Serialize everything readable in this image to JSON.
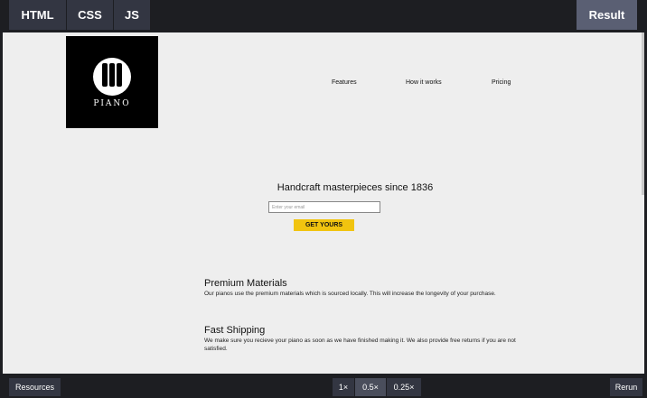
{
  "editor": {
    "tabs": [
      {
        "label": "HTML"
      },
      {
        "label": "CSS"
      },
      {
        "label": "JS"
      }
    ],
    "result_label": "Result",
    "resources_label": "Resources",
    "zoom_options": [
      "1×",
      "0.5×",
      "0.25×"
    ],
    "zoom_selected": "0.5×",
    "rerun_label": "Rerun"
  },
  "site": {
    "logo_text": "PIANO",
    "nav": [
      "Features",
      "How it works",
      "Pricing"
    ],
    "hero_title": "Handcraft masterpieces since 1836",
    "email_placeholder": "Enter your email",
    "cta_label": "GET YOURS",
    "features": [
      {
        "title": "Premium Materials",
        "desc": "Our pianos use the premium materials which is sourced locally. This will increase the longevity of your purchase."
      },
      {
        "title": "Fast Shipping",
        "desc": "We make sure you recieve your piano as soon as we have finished making it. We also provide free returns if you are not satisfied."
      }
    ]
  }
}
